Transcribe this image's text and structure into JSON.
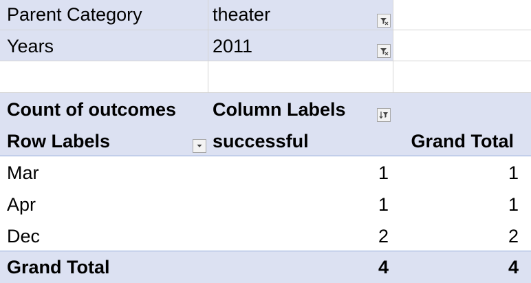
{
  "filters": [
    {
      "label": "Parent Category",
      "value": "theater"
    },
    {
      "label": "Years",
      "value": "2011"
    }
  ],
  "pivot": {
    "value_field": "Count of outcomes",
    "column_labels": "Column Labels",
    "row_labels": "Row Labels",
    "column_value": "successful",
    "grand_total_header": "Grand Total",
    "rows": [
      {
        "label": "Mar",
        "successful": "1",
        "total": "1"
      },
      {
        "label": "Apr",
        "successful": "1",
        "total": "1"
      },
      {
        "label": "Dec",
        "successful": "2",
        "total": "2"
      }
    ],
    "grand_total": {
      "label": "Grand Total",
      "successful": "4",
      "total": "4"
    }
  },
  "icons": {
    "page_filter": "filter-applied-icon",
    "column_filter": "filter-sort-icon",
    "row_dropdown": "chevron-down-icon"
  },
  "colors": {
    "header_band": "#dce1f2",
    "gridline": "#d4d4d4",
    "border_blue": "#8ea9db"
  }
}
